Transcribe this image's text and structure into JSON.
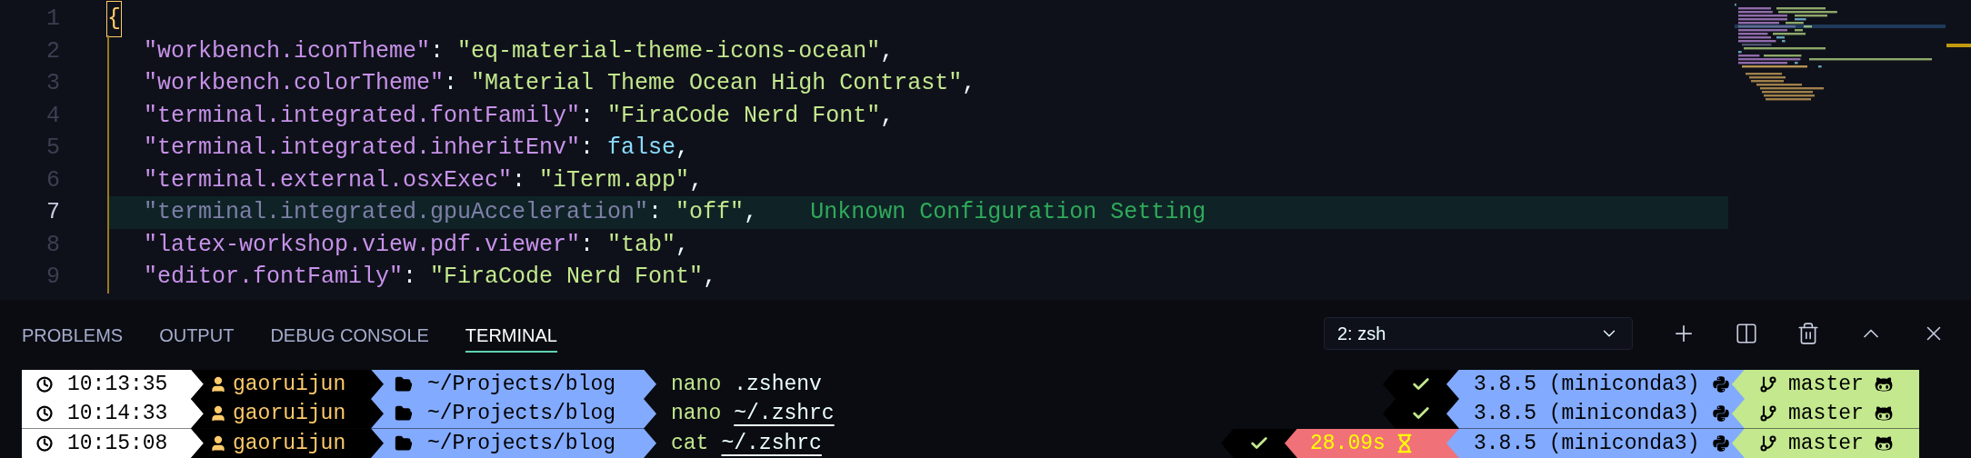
{
  "editor": {
    "lines": [
      {
        "number": "1",
        "current": false,
        "tokens": [
          {
            "kind": "brace",
            "text": "{"
          }
        ]
      },
      {
        "number": "2",
        "current": false,
        "tokens": [
          {
            "kind": "key",
            "text": "\"workbench.iconTheme\""
          },
          {
            "kind": "punct",
            "text": ": "
          },
          {
            "kind": "string",
            "text": "\"eq-material-theme-icons-ocean\""
          },
          {
            "kind": "punct",
            "text": ","
          }
        ]
      },
      {
        "number": "3",
        "current": false,
        "tokens": [
          {
            "kind": "key",
            "text": "\"workbench.colorTheme\""
          },
          {
            "kind": "punct",
            "text": ": "
          },
          {
            "kind": "string",
            "text": "\"Material Theme Ocean High Contrast\""
          },
          {
            "kind": "punct",
            "text": ","
          }
        ]
      },
      {
        "number": "4",
        "current": false,
        "tokens": [
          {
            "kind": "key",
            "text": "\"terminal.integrated.fontFamily\""
          },
          {
            "kind": "punct",
            "text": ": "
          },
          {
            "kind": "string",
            "text": "\"FiraCode Nerd Font\""
          },
          {
            "kind": "punct",
            "text": ","
          }
        ]
      },
      {
        "number": "5",
        "current": false,
        "tokens": [
          {
            "kind": "key",
            "text": "\"terminal.integrated.inheritEnv\""
          },
          {
            "kind": "punct",
            "text": ": "
          },
          {
            "kind": "keyword",
            "text": "false"
          },
          {
            "kind": "punct",
            "text": ","
          }
        ]
      },
      {
        "number": "6",
        "current": false,
        "tokens": [
          {
            "kind": "key",
            "text": "\"terminal.external.osxExec\""
          },
          {
            "kind": "punct",
            "text": ": "
          },
          {
            "kind": "string",
            "text": "\"iTerm.app\""
          },
          {
            "kind": "punct",
            "text": ","
          }
        ]
      },
      {
        "number": "7",
        "current": true,
        "hint": "Unknown Configuration Setting",
        "tokens": [
          {
            "kind": "unknown_key",
            "text": "\"terminal.integrated.gpuAcceleration\""
          },
          {
            "kind": "punct",
            "text": ": "
          },
          {
            "kind": "string",
            "text": "\"off\""
          },
          {
            "kind": "punct",
            "text": ","
          }
        ]
      },
      {
        "number": "8",
        "current": false,
        "tokens": [
          {
            "kind": "key",
            "text": "\"latex-workshop.view.pdf.viewer\""
          },
          {
            "kind": "punct",
            "text": ": "
          },
          {
            "kind": "string",
            "text": "\"tab\""
          },
          {
            "kind": "punct",
            "text": ","
          }
        ]
      },
      {
        "number": "9",
        "current": false,
        "tokens": [
          {
            "kind": "key",
            "text": "\"editor.fontFamily\""
          },
          {
            "kind": "punct",
            "text": ": "
          },
          {
            "kind": "string",
            "text": "\"FiraCode Nerd Font\""
          },
          {
            "kind": "punct",
            "text": ","
          }
        ]
      }
    ]
  },
  "panel": {
    "tabs": [
      {
        "label": "PROBLEMS",
        "selected": false
      },
      {
        "label": "OUTPUT",
        "selected": false
      },
      {
        "label": "DEBUG CONSOLE",
        "selected": false
      },
      {
        "label": "TERMINAL",
        "selected": true
      }
    ],
    "terminal_select": {
      "value": "2: zsh"
    }
  },
  "terminal": {
    "lines": [
      {
        "time": "10:13:35",
        "user": "gaoruijun",
        "path": "~/Projects/blog",
        "command": "nano",
        "argument": ".zshenv",
        "argument_underlined": false,
        "succeeded": true,
        "python": "3.8.5 (miniconda3)",
        "branch": "master"
      },
      {
        "time": "10:14:33",
        "user": "gaoruijun",
        "path": "~/Projects/blog",
        "command": "nano",
        "argument": "~/.zshrc",
        "argument_underlined": true,
        "succeeded": true,
        "python": "3.8.5 (miniconda3)",
        "branch": "master"
      },
      {
        "time": "10:15:08",
        "user": "gaoruijun",
        "path": "~/Projects/blog",
        "command": "cat",
        "argument": "~/.zshrc",
        "argument_underlined": true,
        "succeeded": true,
        "duration": "28.09s",
        "python": "3.8.5 (miniconda3)",
        "branch": "master"
      }
    ]
  }
}
